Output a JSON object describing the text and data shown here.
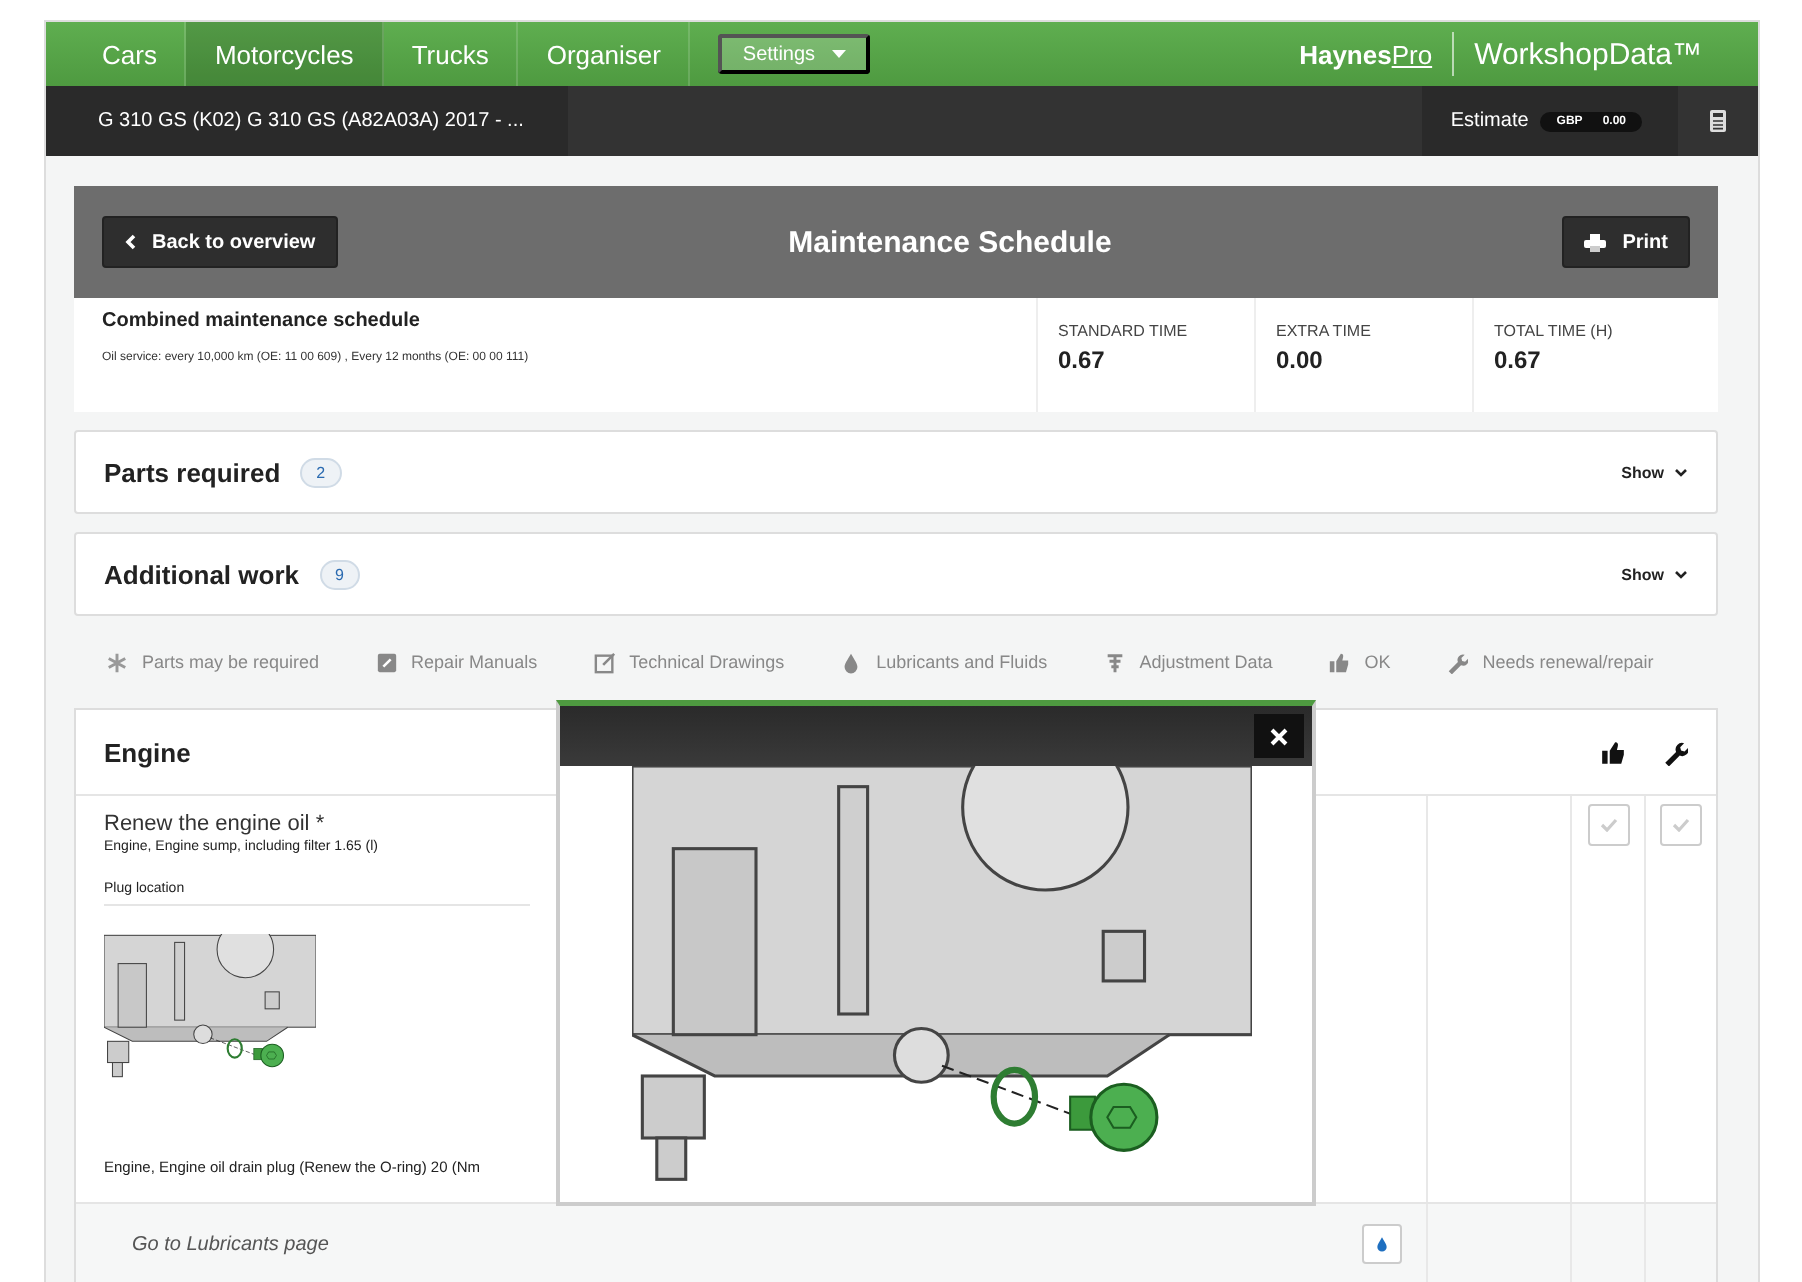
{
  "nav": {
    "tabs": [
      {
        "label": "Cars",
        "selected": false
      },
      {
        "label": "Motorcycles",
        "selected": true
      },
      {
        "label": "Trucks",
        "selected": false
      },
      {
        "label": "Organiser",
        "selected": false
      }
    ],
    "settings": "Settings",
    "brand": {
      "main": "Haynes",
      "suffix": "Pro"
    },
    "product": "WorkshopData™"
  },
  "vehicle_bar": {
    "vehicle": "G 310 GS (K02) G 310 GS (A82A03A) 2017 - ...",
    "estimate_label": "Estimate",
    "currency": "GBP",
    "amount": "0.00"
  },
  "header": {
    "back": "Back to overview",
    "title": "Maintenance Schedule",
    "print": "Print"
  },
  "summary": {
    "title": "Combined maintenance schedule",
    "subtitle": "Oil service: every 10,000 km (OE: 11 00 609) ,  Every 12 months (OE: 00 00 111)",
    "times": [
      {
        "label": "STANDARD TIME",
        "value": "0.67"
      },
      {
        "label": "EXTRA TIME",
        "value": "0.00"
      },
      {
        "label": "TOTAL TIME (H)",
        "value": "0.67"
      }
    ]
  },
  "sections": [
    {
      "title": "Parts required",
      "count": "2",
      "action": "Show"
    },
    {
      "title": "Additional work",
      "count": "9",
      "action": "Show"
    }
  ],
  "legend": [
    {
      "kind": "asterisk",
      "label": "Parts may be required"
    },
    {
      "kind": "manual",
      "label": "Repair Manuals"
    },
    {
      "kind": "drawing",
      "label": "Technical Drawings"
    },
    {
      "kind": "drop",
      "label": "Lubricants and Fluids"
    },
    {
      "kind": "adjust",
      "label": "Adjustment Data"
    },
    {
      "kind": "thumb",
      "label": "OK"
    },
    {
      "kind": "wrench",
      "label": "Needs renewal/repair"
    }
  ],
  "engine": {
    "title": "Engine",
    "task": {
      "title": "Renew the engine oil",
      "mark": "*",
      "detail": "Engine,  Engine sump, including filter 1.65 (l)",
      "image_title": "Plug location",
      "caption": "Engine,  Engine oil drain plug (Renew the O-ring) 20 (Nm",
      "checks": [
        {
          "checked": false
        },
        {
          "checked": false
        }
      ]
    },
    "link": "Go to Lubricants page"
  }
}
